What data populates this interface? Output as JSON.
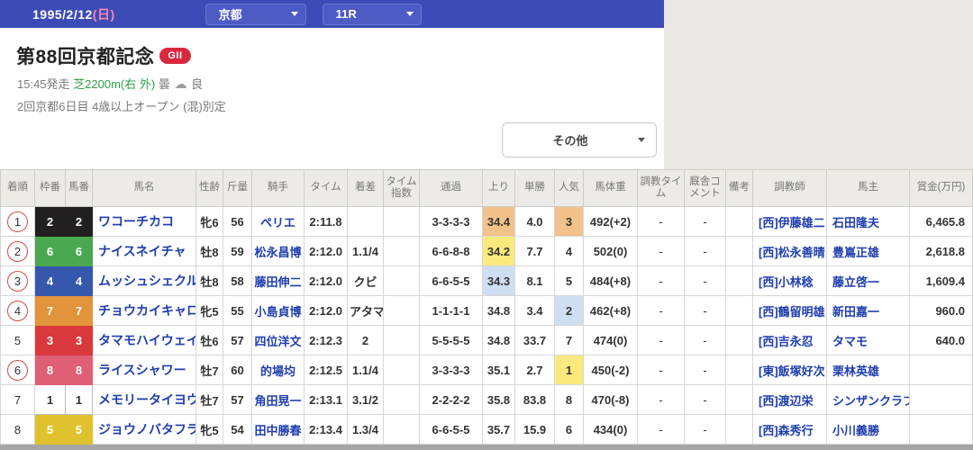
{
  "topbar": {
    "date": "1995/2/12",
    "date_suffix": "(日)",
    "venue": "京都",
    "race_no": "11R"
  },
  "race": {
    "title": "第88回京都記念",
    "grade": "GII",
    "start_time": "15:45発走",
    "course": "芝2200m(右 外)",
    "weather": "曇",
    "weather_icon": "☁",
    "track_condition": "良",
    "meeting_info": "2回京都6日目 4歳以上オープン (混)別定",
    "filter_label": "その他"
  },
  "table": {
    "headers": {
      "rank": "着順",
      "waku": "枠番",
      "umaban": "馬番",
      "name": "馬名",
      "sexage": "性齢",
      "weight": "斤量",
      "jockey": "騎手",
      "time": "タイム",
      "margin": "着差",
      "time_index": "タイム指数",
      "passing": "通過",
      "agari": "上り",
      "odds": "単勝",
      "ninki": "人気",
      "horse_weight": "馬体重",
      "training": "調教タイム",
      "comment": "厩舎コメント",
      "remark": "備考",
      "trainer": "調教師",
      "owner": "馬主",
      "prize": "賞金(万円)"
    },
    "rows": [
      {
        "rank": "1",
        "circled": true,
        "waku": "2",
        "umaban": "2",
        "name": "ワコーチカコ",
        "sexage": "牝6",
        "weight": "56",
        "jockey": "ペリエ",
        "time": "2:11.8",
        "margin": "",
        "time_index": "",
        "passing": "3-3-3-3",
        "agari": "34.4",
        "agari_hl": "third",
        "odds": "4.0",
        "ninki": "3",
        "ninki_hl": "third",
        "horse_weight": "492(+2)",
        "training": "-",
        "comment": "-",
        "remark": "",
        "trainer": "[西]伊藤雄二",
        "owner": "石田隆夫",
        "prize": "6,465.8"
      },
      {
        "rank": "2",
        "circled": true,
        "waku": "6",
        "umaban": "6",
        "name": "ナイスネイチャ",
        "sexage": "牡8",
        "weight": "59",
        "jockey": "松永昌博",
        "time": "2:12.0",
        "margin": "1.1/4",
        "time_index": "",
        "passing": "6-6-8-8",
        "agari": "34.2",
        "agari_hl": "first",
        "odds": "7.7",
        "ninki": "4",
        "ninki_hl": "",
        "horse_weight": "502(0)",
        "training": "-",
        "comment": "-",
        "remark": "",
        "trainer": "[西]松永善晴",
        "owner": "豊嶌正雄",
        "prize": "2,618.8"
      },
      {
        "rank": "3",
        "circled": true,
        "waku": "4",
        "umaban": "4",
        "name": "ムッシュシェクル",
        "sexage": "牡8",
        "weight": "58",
        "jockey": "藤田伸二",
        "time": "2:12.0",
        "margin": "クビ",
        "time_index": "",
        "passing": "6-6-5-5",
        "agari": "34.3",
        "agari_hl": "second",
        "odds": "8.1",
        "ninki": "5",
        "ninki_hl": "",
        "horse_weight": "484(+8)",
        "training": "-",
        "comment": "-",
        "remark": "",
        "trainer": "[西]小林稔",
        "owner": "藤立啓一",
        "prize": "1,609.4"
      },
      {
        "rank": "4",
        "circled": true,
        "waku": "7",
        "umaban": "7",
        "name": "チョウカイキャロル",
        "sexage": "牝5",
        "weight": "55",
        "jockey": "小島貞博",
        "time": "2:12.0",
        "margin": "アタマ",
        "time_index": "",
        "passing": "1-1-1-1",
        "agari": "34.8",
        "agari_hl": "",
        "odds": "3.4",
        "ninki": "2",
        "ninki_hl": "second",
        "horse_weight": "462(+8)",
        "training": "-",
        "comment": "-",
        "remark": "",
        "trainer": "[西]鶴留明雄",
        "owner": "新田嘉一",
        "prize": "960.0"
      },
      {
        "rank": "5",
        "circled": false,
        "waku": "3",
        "umaban": "3",
        "name": "タマモハイウェイ",
        "sexage": "牡6",
        "weight": "57",
        "jockey": "四位洋文",
        "time": "2:12.3",
        "margin": "2",
        "time_index": "",
        "passing": "5-5-5-5",
        "agari": "34.8",
        "agari_hl": "",
        "odds": "33.7",
        "ninki": "7",
        "ninki_hl": "",
        "horse_weight": "474(0)",
        "training": "-",
        "comment": "-",
        "remark": "",
        "trainer": "[西]吉永忍",
        "owner": "タマモ",
        "prize": "640.0"
      },
      {
        "rank": "6",
        "circled": true,
        "waku": "8",
        "umaban": "8",
        "name": "ライスシャワー",
        "sexage": "牡7",
        "weight": "60",
        "jockey": "的場均",
        "time": "2:12.5",
        "margin": "1.1/4",
        "time_index": "",
        "passing": "3-3-3-3",
        "agari": "35.1",
        "agari_hl": "",
        "odds": "2.7",
        "ninki": "1",
        "ninki_hl": "first",
        "horse_weight": "450(-2)",
        "training": "-",
        "comment": "-",
        "remark": "",
        "trainer": "[東]飯塚好次",
        "owner": "栗林英雄",
        "prize": ""
      },
      {
        "rank": "7",
        "circled": false,
        "waku": "1",
        "umaban": "1",
        "name": "メモリータイヨウ",
        "sexage": "牡7",
        "weight": "57",
        "jockey": "角田晃一",
        "time": "2:13.1",
        "margin": "3.1/2",
        "time_index": "",
        "passing": "2-2-2-2",
        "agari": "35.8",
        "agari_hl": "",
        "odds": "83.8",
        "ninki": "8",
        "ninki_hl": "",
        "horse_weight": "470(-8)",
        "training": "-",
        "comment": "-",
        "remark": "",
        "trainer": "[西]渡辺栄",
        "owner": "シンザンクラブ",
        "prize": ""
      },
      {
        "rank": "8",
        "circled": false,
        "waku": "5",
        "umaban": "5",
        "name": "ジョウノバタフライ",
        "sexage": "牝5",
        "weight": "54",
        "jockey": "田中勝春",
        "time": "2:13.4",
        "margin": "1.3/4",
        "time_index": "",
        "passing": "6-6-5-5",
        "agari": "35.7",
        "agari_hl": "",
        "odds": "15.9",
        "ninki": "6",
        "ninki_hl": "",
        "horse_weight": "434(0)",
        "training": "-",
        "comment": "-",
        "remark": "",
        "trainer": "[西]森秀行",
        "owner": "小川義勝",
        "prize": ""
      }
    ]
  },
  "colors": {
    "accent_blue": "#3c4bb5",
    "grade_red": "#d9293f",
    "course_green": "#2ca04a",
    "link_blue": "#1f3dae",
    "highlight_first": "#fae97c",
    "highlight_second": "#cfdff2",
    "highlight_third": "#f3c28b",
    "waku": {
      "1": {
        "bg": "#ffffff",
        "fg": "#333333",
        "border": "#bbbbbb"
      },
      "2": {
        "bg": "#211f1f",
        "fg": "#ffffff",
        "border": "#211f1f"
      },
      "3": {
        "bg": "#d9383c",
        "fg": "#ffffff",
        "border": "#d9383c"
      },
      "4": {
        "bg": "#3558ad",
        "fg": "#ffffff",
        "border": "#3558ad"
      },
      "5": {
        "bg": "#dfc22e",
        "fg": "#ffffff",
        "border": "#dfc22e"
      },
      "6": {
        "bg": "#4aa850",
        "fg": "#ffffff",
        "border": "#4aa850"
      },
      "7": {
        "bg": "#e2943a",
        "fg": "#ffffff",
        "border": "#e2943a"
      },
      "8": {
        "bg": "#df5f75",
        "fg": "#ffffff",
        "border": "#df5f75"
      }
    }
  }
}
